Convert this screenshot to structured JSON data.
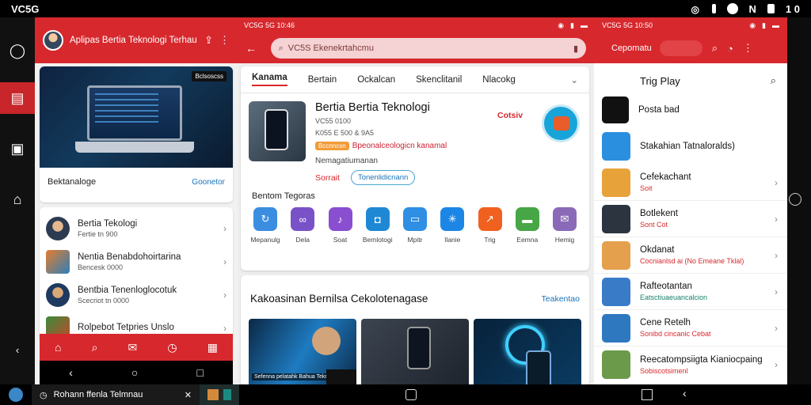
{
  "statusbar": {
    "left_text": "VC5G",
    "right_text": "1 0"
  },
  "colors": {
    "accent": "#d7282d",
    "link": "#1a73b8",
    "outline": "#48a6d6",
    "badge": "#f29b38"
  },
  "rail": {
    "icons": [
      "chat-icon",
      "gallery-icon",
      "calendar-icon",
      "home-icon",
      "back-icon"
    ]
  },
  "left_panel": {
    "header_title": "Aplipas Bertia Teknologi Terhau",
    "hero": {
      "tag": "Bclsoscss",
      "caption": "Bektanaloge",
      "link": "Goonetor"
    },
    "list": [
      {
        "title": "Bertia Tekologi",
        "sub": "Fertie tn 900"
      },
      {
        "title": "Nentia Benabdohoirtarina",
        "sub": "Bencesk 0000"
      },
      {
        "title": "Bentbia Tenenloglocotuk",
        "sub": "Scecriot tn 0000"
      },
      {
        "title": "Rolpebot Tetpries Unslo",
        "sub": ""
      }
    ],
    "bottom_nav": [
      "home-icon",
      "search-icon",
      "mail-icon",
      "clock-icon",
      "grid-icon"
    ],
    "sys_nav": [
      "back-icon",
      "home-circle-icon",
      "square-icon"
    ]
  },
  "middle_panel": {
    "status_left": "VC5G 5G 10:46",
    "search_placeholder": "VC5S Ekenekrtahcmu",
    "tabs": [
      "Kanama",
      "Bertain",
      "Ockalcan",
      "Skenclitanil",
      "Nlacokg"
    ],
    "app": {
      "name": "Bertia Bertia Teknologi",
      "meta1": "VC55 0100",
      "meta2": "K055 E 500 & 9A5",
      "badge": "Bccnncsn",
      "promo": "Bpeonalceologicn kanamal",
      "sub": "Nemagatiumanan",
      "price": "Cotsiv",
      "action_link": "Sorrait",
      "action_button": "Tonenlidicnann"
    },
    "section_title": "Bentom Tegoras",
    "grid": [
      {
        "label": "Mepanulg",
        "color": "#3b8de0",
        "icon": "refresh-icon"
      },
      {
        "label": "Dela",
        "color": "#7a52c8",
        "icon": "link-icon"
      },
      {
        "label": "Soat",
        "color": "#8a4ed0",
        "icon": "music-icon"
      },
      {
        "label": "Bemlotogi",
        "color": "#1f88d4",
        "icon": "shield-icon"
      },
      {
        "label": "Mpitr",
        "color": "#2e8fe4",
        "icon": "card-icon"
      },
      {
        "label": "Ilanie",
        "color": "#1c86e6",
        "icon": "sparkle-icon"
      },
      {
        "label": "Trig",
        "color": "#f0611f",
        "icon": "chart-icon"
      },
      {
        "label": "Eemna",
        "color": "#47a645",
        "icon": "message-icon"
      },
      {
        "label": "Hemig",
        "color": "#8a6ab8",
        "icon": "mail-icon"
      }
    ],
    "card2": {
      "title": "Kakoasinan Bernilsa Cekolotenagase",
      "link": "Teakentao",
      "thumb_caption": "Sefenna pelatahk Bahua Teknoogrosi"
    }
  },
  "right_panel": {
    "status_left": "VC5G 5G 10:50",
    "header_text": "Cepomatu",
    "title": "Trig Play",
    "items": [
      {
        "a": "Posta bad",
        "b": "",
        "color": "#111",
        "variant": "red"
      },
      {
        "a": "Stakahian Tatnaloralds)",
        "b": "",
        "color": "#2b8fe0",
        "variant": "red"
      },
      {
        "a": "Cefekachant",
        "b": "Soit",
        "color": "#e7a23a",
        "variant": "red"
      },
      {
        "a": "Botlekent",
        "b": "Sont Cot",
        "color": "#2c3440",
        "variant": "red"
      },
      {
        "a": "Okdanat",
        "b": "Cocnianlsd ai (No Emeane Tklal)",
        "color": "#e4a04c",
        "variant": "red"
      },
      {
        "a": "Rafteotantan",
        "b": "Eatsctiuaeuancalcion",
        "color": "#3a7bc8",
        "variant": "teal"
      },
      {
        "a": "Cene Retelh",
        "b": "Sonibd cincanic Cebat",
        "color": "#2e78c0",
        "variant": "red"
      },
      {
        "a": "Reecatompsiigta Kianiocpaing",
        "b": "Sobiscotsimenl",
        "color": "#6a9a4a",
        "variant": "red"
      }
    ]
  },
  "taskbar": {
    "task_label": "Rohann ffenla Telmnau"
  }
}
